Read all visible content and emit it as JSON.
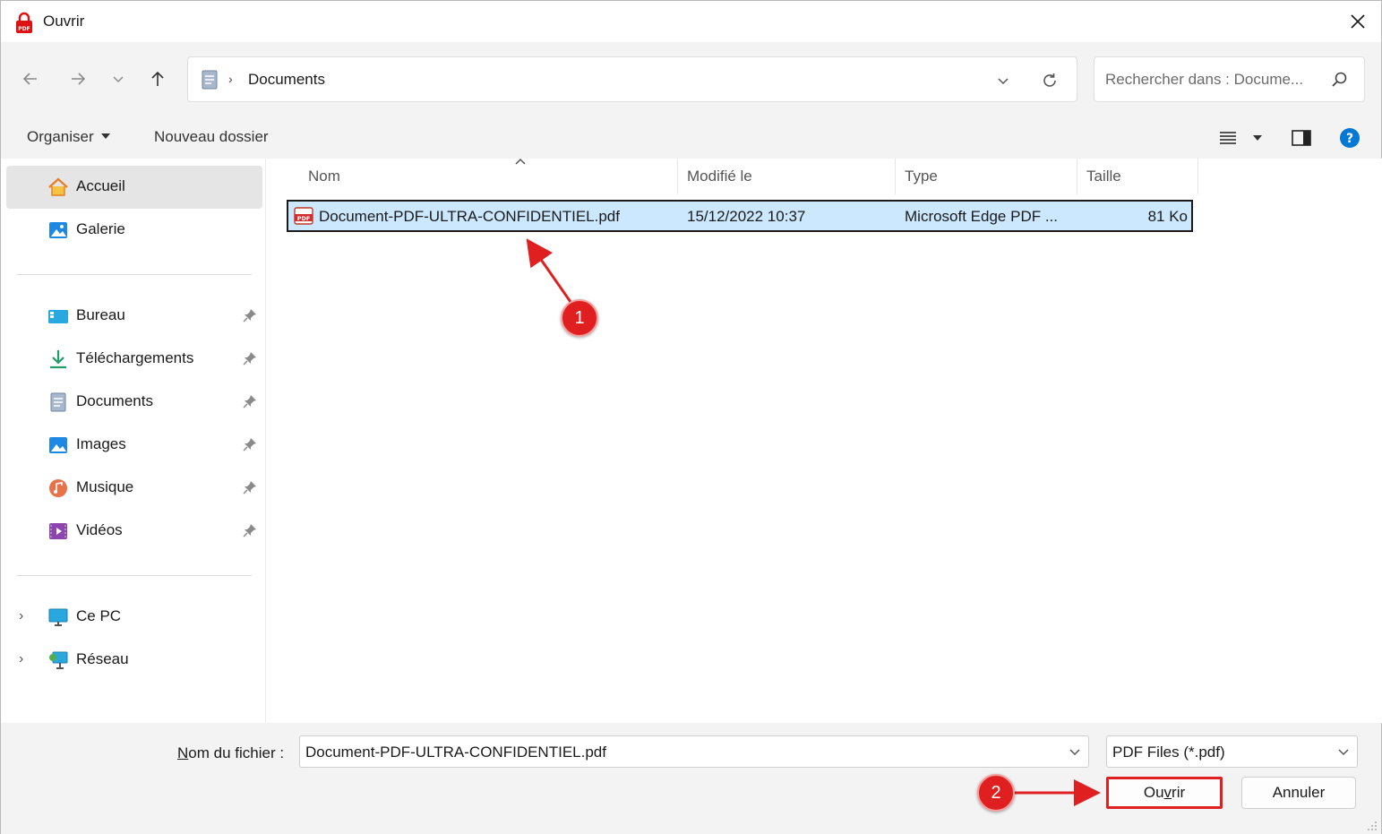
{
  "window": {
    "title": "Ouvrir"
  },
  "address": {
    "crumb": "Documents"
  },
  "search": {
    "placeholder": "Rechercher dans : Docume..."
  },
  "toolbar": {
    "organize": "Organiser",
    "new_folder": "Nouveau dossier"
  },
  "sidebar": {
    "home": "Accueil",
    "gallery": "Galerie",
    "quick": [
      "Bureau",
      "Téléchargements",
      "Documents",
      "Images",
      "Musique",
      "Vidéos"
    ],
    "pc": "Ce PC",
    "network": "Réseau"
  },
  "columns": {
    "name": "Nom",
    "modified": "Modifié le",
    "type": "Type",
    "size": "Taille"
  },
  "files": [
    {
      "name": "Document-PDF-ULTRA-CONFIDENTIEL.pdf",
      "modified": "15/12/2022 10:37",
      "type": "Microsoft Edge PDF ...",
      "size": "81 Ko"
    }
  ],
  "bottom": {
    "filename_label_prefix": "N",
    "filename_label_rest": "om du fichier :",
    "filename_value": "Document-PDF-ULTRA-CONFIDENTIEL.pdf",
    "filter": "PDF Files (*.pdf)",
    "open_prefix": "Ou",
    "open_accel": "v",
    "open_rest": "rir",
    "cancel": "Annuler"
  },
  "annotations": {
    "step1": "1",
    "step2": "2",
    "color": "#e02020"
  },
  "colors": {
    "selection": "#cce8ff",
    "accent": "#0078d4",
    "chrome": "#f3f3f3"
  }
}
